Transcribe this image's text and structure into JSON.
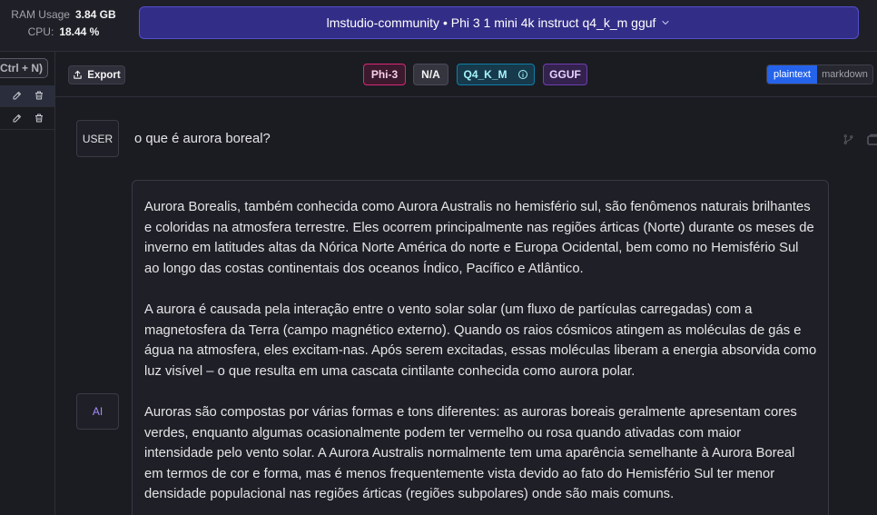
{
  "header": {
    "ram_label": "RAM Usage",
    "ram_value": "3.84 GB",
    "cpu_label": "CPU:",
    "cpu_value": "18.44 %",
    "model_selector": "lmstudio-community • Phi 3 1 mini 4k instruct q4_k_m gguf"
  },
  "sidebar": {
    "new_chat_shortcut": "Ctrl + N)",
    "chats": [
      {
        "selected": true
      },
      {
        "selected": false
      }
    ]
  },
  "toolbar": {
    "export_label": "Export",
    "badges": [
      {
        "label": "Phi-3",
        "bg": "#3b1a2d",
        "border": "#db2777",
        "text": "#fbcfe8"
      },
      {
        "label": "N/A",
        "bg": "#34353f",
        "border": "#4a4b57",
        "text": "#f4f4f5"
      },
      {
        "label": "Q4_K_M",
        "bg": "#16394b",
        "border": "#0e7fa8",
        "text": "#a5f3fc",
        "info": true
      },
      {
        "label": "GGUF",
        "bg": "#33224d",
        "border": "#6d3fb0",
        "text": "#e9d5ff"
      }
    ],
    "format_toggle": {
      "options": [
        "plaintext",
        "markdown"
      ],
      "selected": "plaintext"
    }
  },
  "messages": [
    {
      "role": "USER",
      "text": "o que é aurora boreal?"
    },
    {
      "role": "AI",
      "paragraphs": [
        [
          "Aurora Borealis, também conhecida como Aurora Australis no hemisfério sul, são fenômenos naturais brilhantes",
          "e coloridas na atmosfera terrestre. Eles ocorrem principalmente nas regiões árticas (Norte) durante os meses de",
          "inverno em latitudes altas da Nórica Norte América do norte e Europa Ocidental, bem como no Hemisfério Sul",
          "ao longo das costas continentais dos oceanos Índico, Pacífico e Atlântico."
        ],
        [
          "A aurora é causada pela interação entre o vento solar solar (um fluxo de partículas carregadas) com a",
          "magnetosfera da Terra (campo magnético externo). Quando os raios cósmicos atingem as moléculas de gás e",
          "água na atmosfera, eles excitam-nas. Após serem excitadas, essas moléculas liberam a energia absorvida como",
          "luz visível – o que resulta em uma cascata cintilante conhecida como aurora polar."
        ],
        [
          "Auroras são compostas por várias formas e tons diferentes: as auroras boreais geralmente apresentam cores",
          "verdes, enquanto algumas ocasionalmente podem ter vermelho ou rosa quando ativadas com maior",
          "intensidade pelo vento solar. A Aurora Australis normalmente tem uma aparência semelhante à Aurora Boreal",
          "em termos de cor e forma, mas é menos frequentemente vista devido ao fato do Hemisfério Sul ter menor",
          "densidade populacional nas regiões árticas (regiões subpolares) onde são mais comuns."
        ]
      ]
    }
  ],
  "theme": {
    "app_bg": "#1b1c22",
    "topbar_bg": "#1f2027",
    "border": "#2e2f38",
    "surface": "#1f2027",
    "surface_border": "#383944",
    "text": "#e4e4e7",
    "muted_text": "#a1a1aa",
    "model_selector_bg": "#322d86",
    "model_selector_border": "#554fcf",
    "accent": "#2563eb",
    "ai_label": "#a78bfa",
    "selected_row": "#2a2e3c"
  },
  "icons": {
    "model_selector": "chevron-down-icon",
    "export": "share-icon",
    "chat_edit": "pencil-icon",
    "chat_delete": "trash-icon",
    "quant_info": "info-icon",
    "message_branch": "branch-icon",
    "message_copy": "copy-icon"
  }
}
